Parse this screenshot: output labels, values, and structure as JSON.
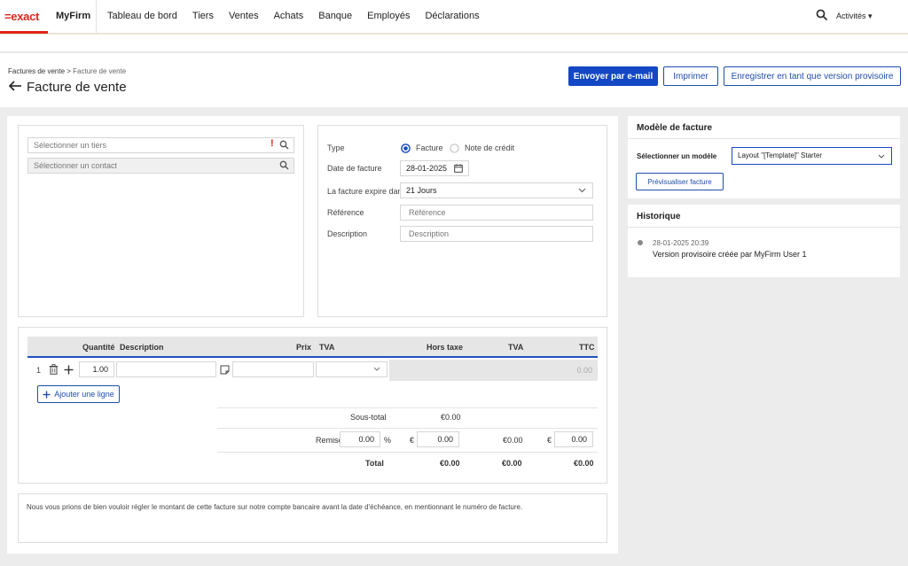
{
  "nav": {
    "logo": "=exact",
    "firm": "MyFirm",
    "items": [
      "Tableau de bord",
      "Tiers",
      "Ventes",
      "Achats",
      "Banque",
      "Employés",
      "Déclarations"
    ],
    "activities": "Activités ▾"
  },
  "header": {
    "breadcrumb_parent": "Factures de vente",
    "breadcrumb_sep": " > ",
    "breadcrumb_current": "Facture de vente",
    "title": "Facture de vente",
    "send_email": "Envoyer par e-mail",
    "print": "Imprimer",
    "save_draft": "Enregistrer en tant que version provisoire"
  },
  "party": {
    "tiers_placeholder": "Sélectionner un tiers",
    "contact_placeholder": "Sélectionner un contact",
    "required_mark": "!"
  },
  "details": {
    "type_label": "Type",
    "type_invoice": "Facture",
    "type_credit": "Note de crédit",
    "date_label": "Date de facture",
    "date_value": "28-01-2025",
    "expires_label": "La facture expire dans",
    "expires_value": "21 Jours",
    "reference_label": "Référence",
    "reference_placeholder": "Référence",
    "description_label": "Description",
    "description_placeholder": "Description"
  },
  "lines": {
    "headers": {
      "quantity": "Quantité",
      "description": "Description",
      "price": "Prix",
      "vat": "TVA",
      "excl": "Hors taxe",
      "vat_amount": "TVA",
      "incl": "TTC"
    },
    "row": {
      "number": "1",
      "quantity": "1.00",
      "ttc": "0.00"
    },
    "add_line": "Ajouter une ligne"
  },
  "totals": {
    "subtotal_label": "Sous-total",
    "subtotal_excl": "€0.00",
    "discount_label": "Remise",
    "discount_pct": "0.00",
    "pct_sign": "%",
    "euro": "€",
    "discount_amount": "0.00",
    "discount_vat": "€0.00",
    "discount_ttc": "0.00",
    "total_label": "Total",
    "total_excl": "€0.00",
    "total_vat": "€0.00",
    "total_ttc": "€0.00"
  },
  "footer_note": "Nous vous prions de bien vouloir régler le montant de cette facture sur notre compte bancaire avant la date d'échéance, en mentionnant le numéro de facture.",
  "template": {
    "title": "Modèle de facture",
    "select_label": "Sélectionner un modèle",
    "select_value": "Layout \"[Template]\" Starter",
    "preview": "Prévisualiser facture"
  },
  "history": {
    "title": "Historique",
    "timestamp": "28-01-2025 20:39",
    "event": "Version provisoire créée par MyFirm User 1"
  },
  "colors": {
    "brand_red": "#e1261c",
    "primary_blue": "#1447c3",
    "grey_bg": "#ececec"
  }
}
